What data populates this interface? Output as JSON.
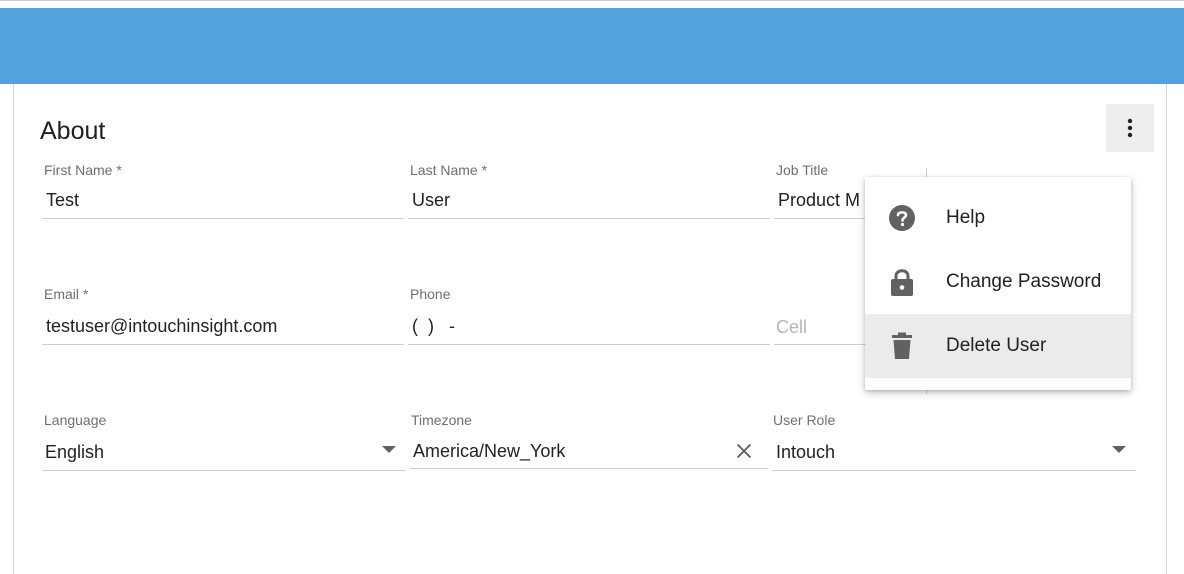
{
  "section_title": "About",
  "fields": {
    "first_name": {
      "label": "First Name *",
      "value": "Test"
    },
    "last_name": {
      "label": "Last Name *",
      "value": "User"
    },
    "job_title": {
      "label": "Job Title",
      "value": "Product M"
    },
    "email": {
      "label": "Email *",
      "value": "testuser@intouchinsight.com"
    },
    "phone": {
      "label": "Phone",
      "value": "(  )   -"
    },
    "cell": {
      "placeholder": "Cell"
    },
    "language": {
      "label": "Language",
      "value": "English"
    },
    "timezone": {
      "label": "Timezone",
      "value": "America/New_York"
    },
    "user_role": {
      "label": "User Role",
      "value": "Intouch"
    }
  },
  "menu": {
    "items": [
      {
        "label": "Help",
        "icon": "help-icon"
      },
      {
        "label": "Change Password",
        "icon": "lock-icon"
      },
      {
        "label": "Delete User",
        "icon": "trash-icon",
        "highlighted": true
      }
    ]
  },
  "colors": {
    "header": "#52a2db",
    "menu_highlight": "#ebebeb",
    "icon": "#616161"
  }
}
